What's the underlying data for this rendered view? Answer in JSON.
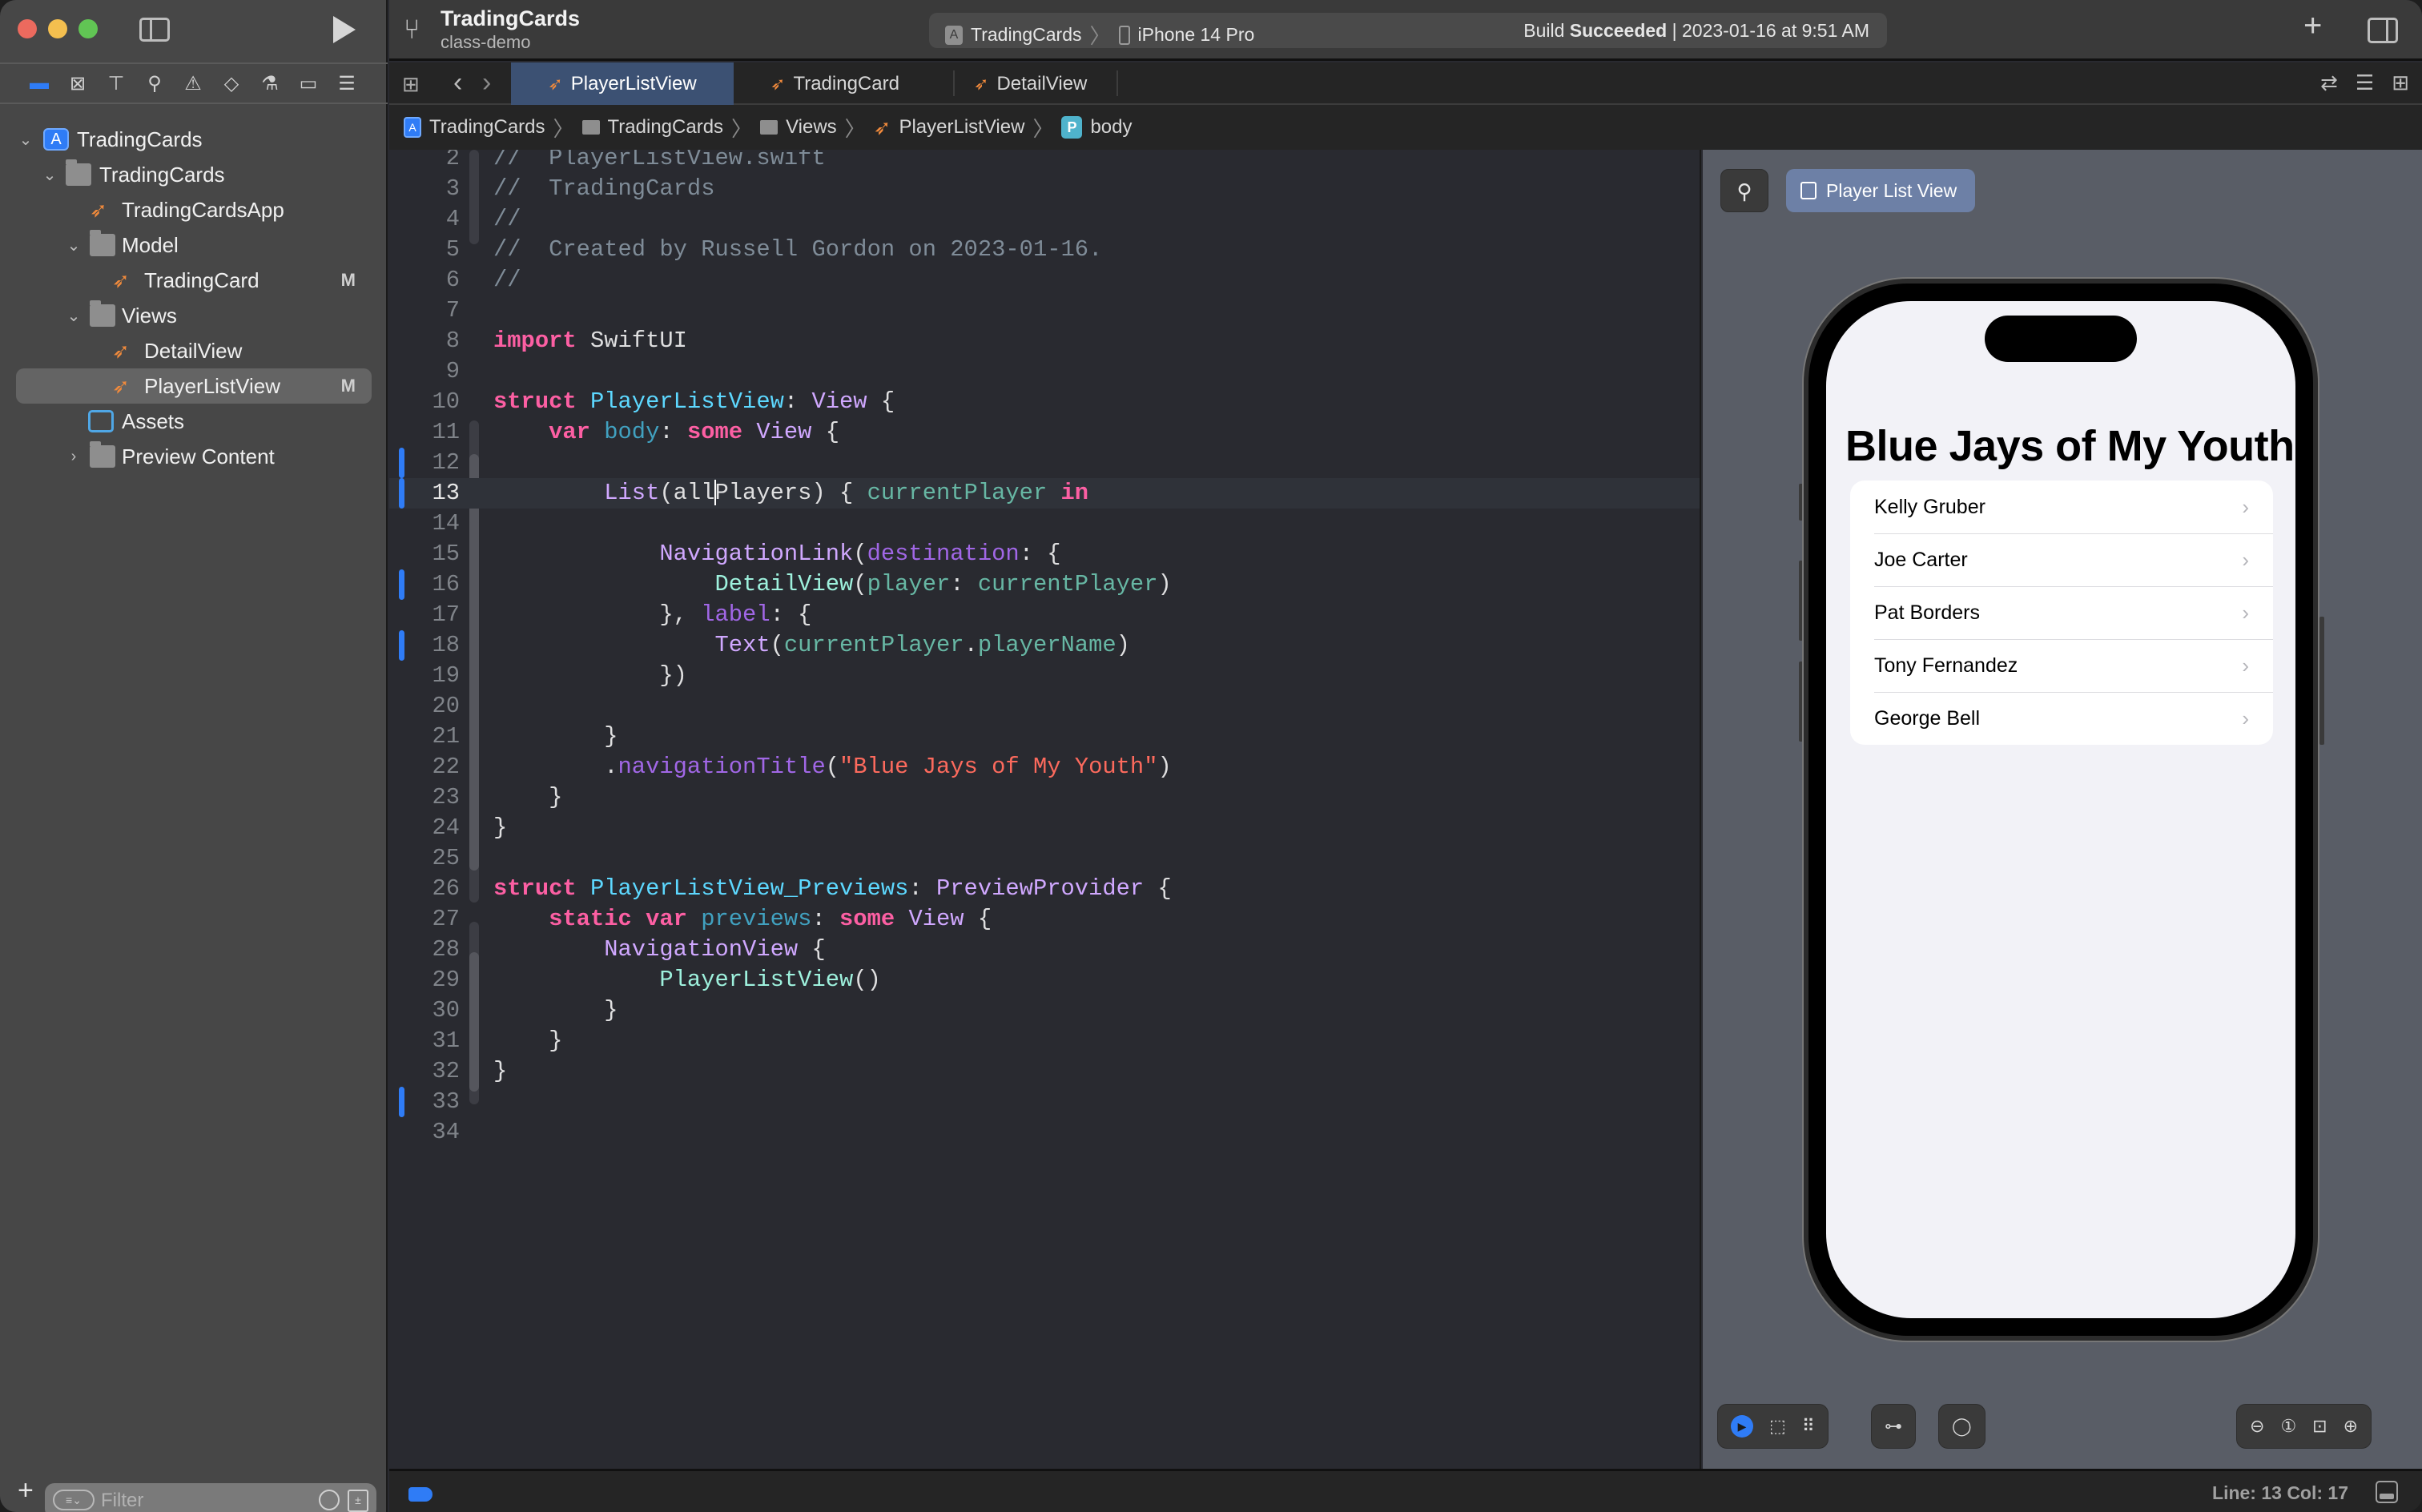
{
  "window": {
    "project_name": "TradingCards",
    "branch": "class-demo"
  },
  "activity": {
    "scheme": "TradingCards",
    "destination": "iPhone 14 Pro",
    "status_prefix": "Build",
    "status_bold": "Succeeded",
    "status_separator": "|",
    "status_time": "2023-01-16 at 9:51 AM"
  },
  "navigator": {
    "icons": [
      "folder-icon",
      "source-control-icon",
      "hierarchy-icon",
      "search-icon",
      "warning-icon",
      "test-icon",
      "debug-icon",
      "breakpoint-icon",
      "report-icon"
    ],
    "tree": [
      {
        "label": "TradingCards",
        "kind": "project",
        "expanded": true,
        "badge": ""
      },
      {
        "label": "TradingCards",
        "kind": "folder",
        "expanded": true,
        "badge": ""
      },
      {
        "label": "TradingCardsApp",
        "kind": "swift",
        "badge": ""
      },
      {
        "label": "Model",
        "kind": "folder",
        "expanded": true,
        "badge": ""
      },
      {
        "label": "TradingCard",
        "kind": "swift",
        "badge": "M"
      },
      {
        "label": "Views",
        "kind": "folder",
        "expanded": true,
        "badge": ""
      },
      {
        "label": "DetailView",
        "kind": "swift",
        "badge": ""
      },
      {
        "label": "PlayerListView",
        "kind": "swift",
        "badge": "M",
        "selected": true
      },
      {
        "label": "Assets",
        "kind": "assets",
        "badge": ""
      },
      {
        "label": "Preview Content",
        "kind": "folder",
        "expanded": false,
        "badge": ""
      }
    ],
    "filter_placeholder": "Filter"
  },
  "tabs": [
    {
      "label": "PlayerListView",
      "active": true
    },
    {
      "label": "TradingCard",
      "active": false
    },
    {
      "label": "DetailView",
      "active": false
    }
  ],
  "breadcrumb": [
    "TradingCards",
    "TradingCards",
    "Views",
    "PlayerListView",
    "body"
  ],
  "editor": {
    "current_line": 13,
    "lines": [
      {
        "n": 2,
        "text": "//  PlayerListView.swift"
      },
      {
        "n": 3,
        "text": "//  TradingCards"
      },
      {
        "n": 4,
        "text": "//"
      },
      {
        "n": 5,
        "text": "//  Created by Russell Gordon on 2023-01-16."
      },
      {
        "n": 6,
        "text": "//"
      },
      {
        "n": 7,
        "text": ""
      },
      {
        "n": 8,
        "text": "import SwiftUI"
      },
      {
        "n": 9,
        "text": ""
      },
      {
        "n": 10,
        "text": "struct PlayerListView: View {"
      },
      {
        "n": 11,
        "text": "    var body: some View {"
      },
      {
        "n": 12,
        "text": ""
      },
      {
        "n": 13,
        "text": "        List(allPlayers) { currentPlayer in"
      },
      {
        "n": 14,
        "text": ""
      },
      {
        "n": 15,
        "text": "            NavigationLink(destination: {"
      },
      {
        "n": 16,
        "text": "                DetailView(player: currentPlayer)"
      },
      {
        "n": 17,
        "text": "            }, label: {"
      },
      {
        "n": 18,
        "text": "                Text(currentPlayer.playerName)"
      },
      {
        "n": 19,
        "text": "            })"
      },
      {
        "n": 20,
        "text": ""
      },
      {
        "n": 21,
        "text": "        }"
      },
      {
        "n": 22,
        "text": "        .navigationTitle(\"Blue Jays of My Youth\")"
      },
      {
        "n": 23,
        "text": "    }"
      },
      {
        "n": 24,
        "text": "}"
      },
      {
        "n": 25,
        "text": ""
      },
      {
        "n": 26,
        "text": "struct PlayerListView_Previews: PreviewProvider {"
      },
      {
        "n": 27,
        "text": "    static var previews: some View {"
      },
      {
        "n": 28,
        "text": "        NavigationView {"
      },
      {
        "n": 29,
        "text": "            PlayerListView()"
      },
      {
        "n": 30,
        "text": "        }"
      },
      {
        "n": 31,
        "text": "    }"
      },
      {
        "n": 32,
        "text": "}"
      },
      {
        "n": 33,
        "text": ""
      },
      {
        "n": 34,
        "text": ""
      }
    ],
    "changed_lines": [
      12,
      13,
      16,
      18,
      33
    ]
  },
  "preview": {
    "pin_icon": "pin-icon",
    "chip_label": "Player List View",
    "nav_title": "Blue Jays of My Youth",
    "players": [
      "Kelly Gruber",
      "Joe Carter",
      "Pat Borders",
      "Tony Fernandez",
      "George Bell"
    ],
    "toolbar_left": [
      "live-mode-icon",
      "selectable-mode-icon",
      "variants-icon"
    ],
    "toolbar_mid": [
      "device-settings-icon"
    ],
    "toolbar_device": [
      "device-icon"
    ],
    "toolbar_zoom": [
      "zoom-out-icon",
      "zoom-100-icon",
      "zoom-fit-icon",
      "zoom-in-icon"
    ]
  },
  "statusbar": {
    "cursor_position": "Line: 13  Col: 17"
  },
  "colors": {
    "accent": "#2f7cf6",
    "swift_orange": "#f08a3c",
    "active_tab": "#3c5173",
    "preview_chip": "#6d80a6",
    "editor_bg": "#292a30",
    "sidebar_bg": "#474747",
    "preview_bg": "#595d66"
  }
}
